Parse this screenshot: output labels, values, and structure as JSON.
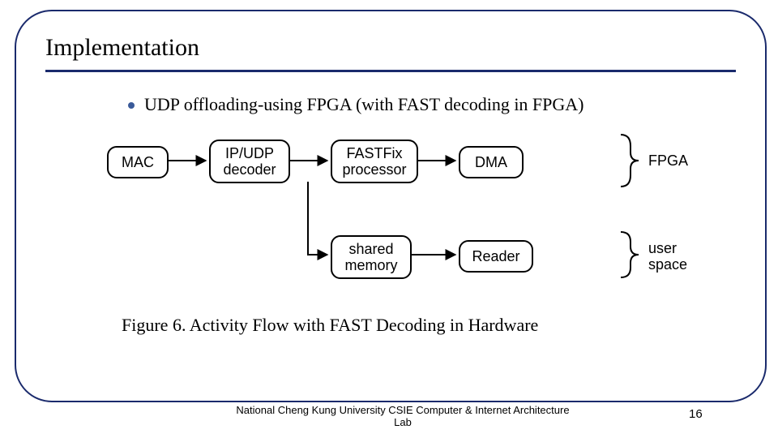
{
  "slide": {
    "title": "Implementation",
    "bullet": "UDP offloading-using FPGA (with FAST decoding in FPGA)",
    "caption": "Figure 6.  Activity Flow with FAST Decoding in Hardware",
    "footer": "National Cheng Kung University CSIE Computer & Internet Architecture Lab",
    "page_number": "16"
  },
  "diagram": {
    "nodes": {
      "mac": "MAC",
      "ipudp_line1": "IP/UDP",
      "ipudp_line2": "decoder",
      "fastfix_line1": "FASTFix",
      "fastfix_line2": "processor",
      "dma": "DMA",
      "shared_line1": "shared",
      "shared_line2": "memory",
      "reader": "Reader"
    },
    "groups": {
      "fpga": "FPGA",
      "user_line1": "user",
      "user_line2": "space"
    }
  }
}
